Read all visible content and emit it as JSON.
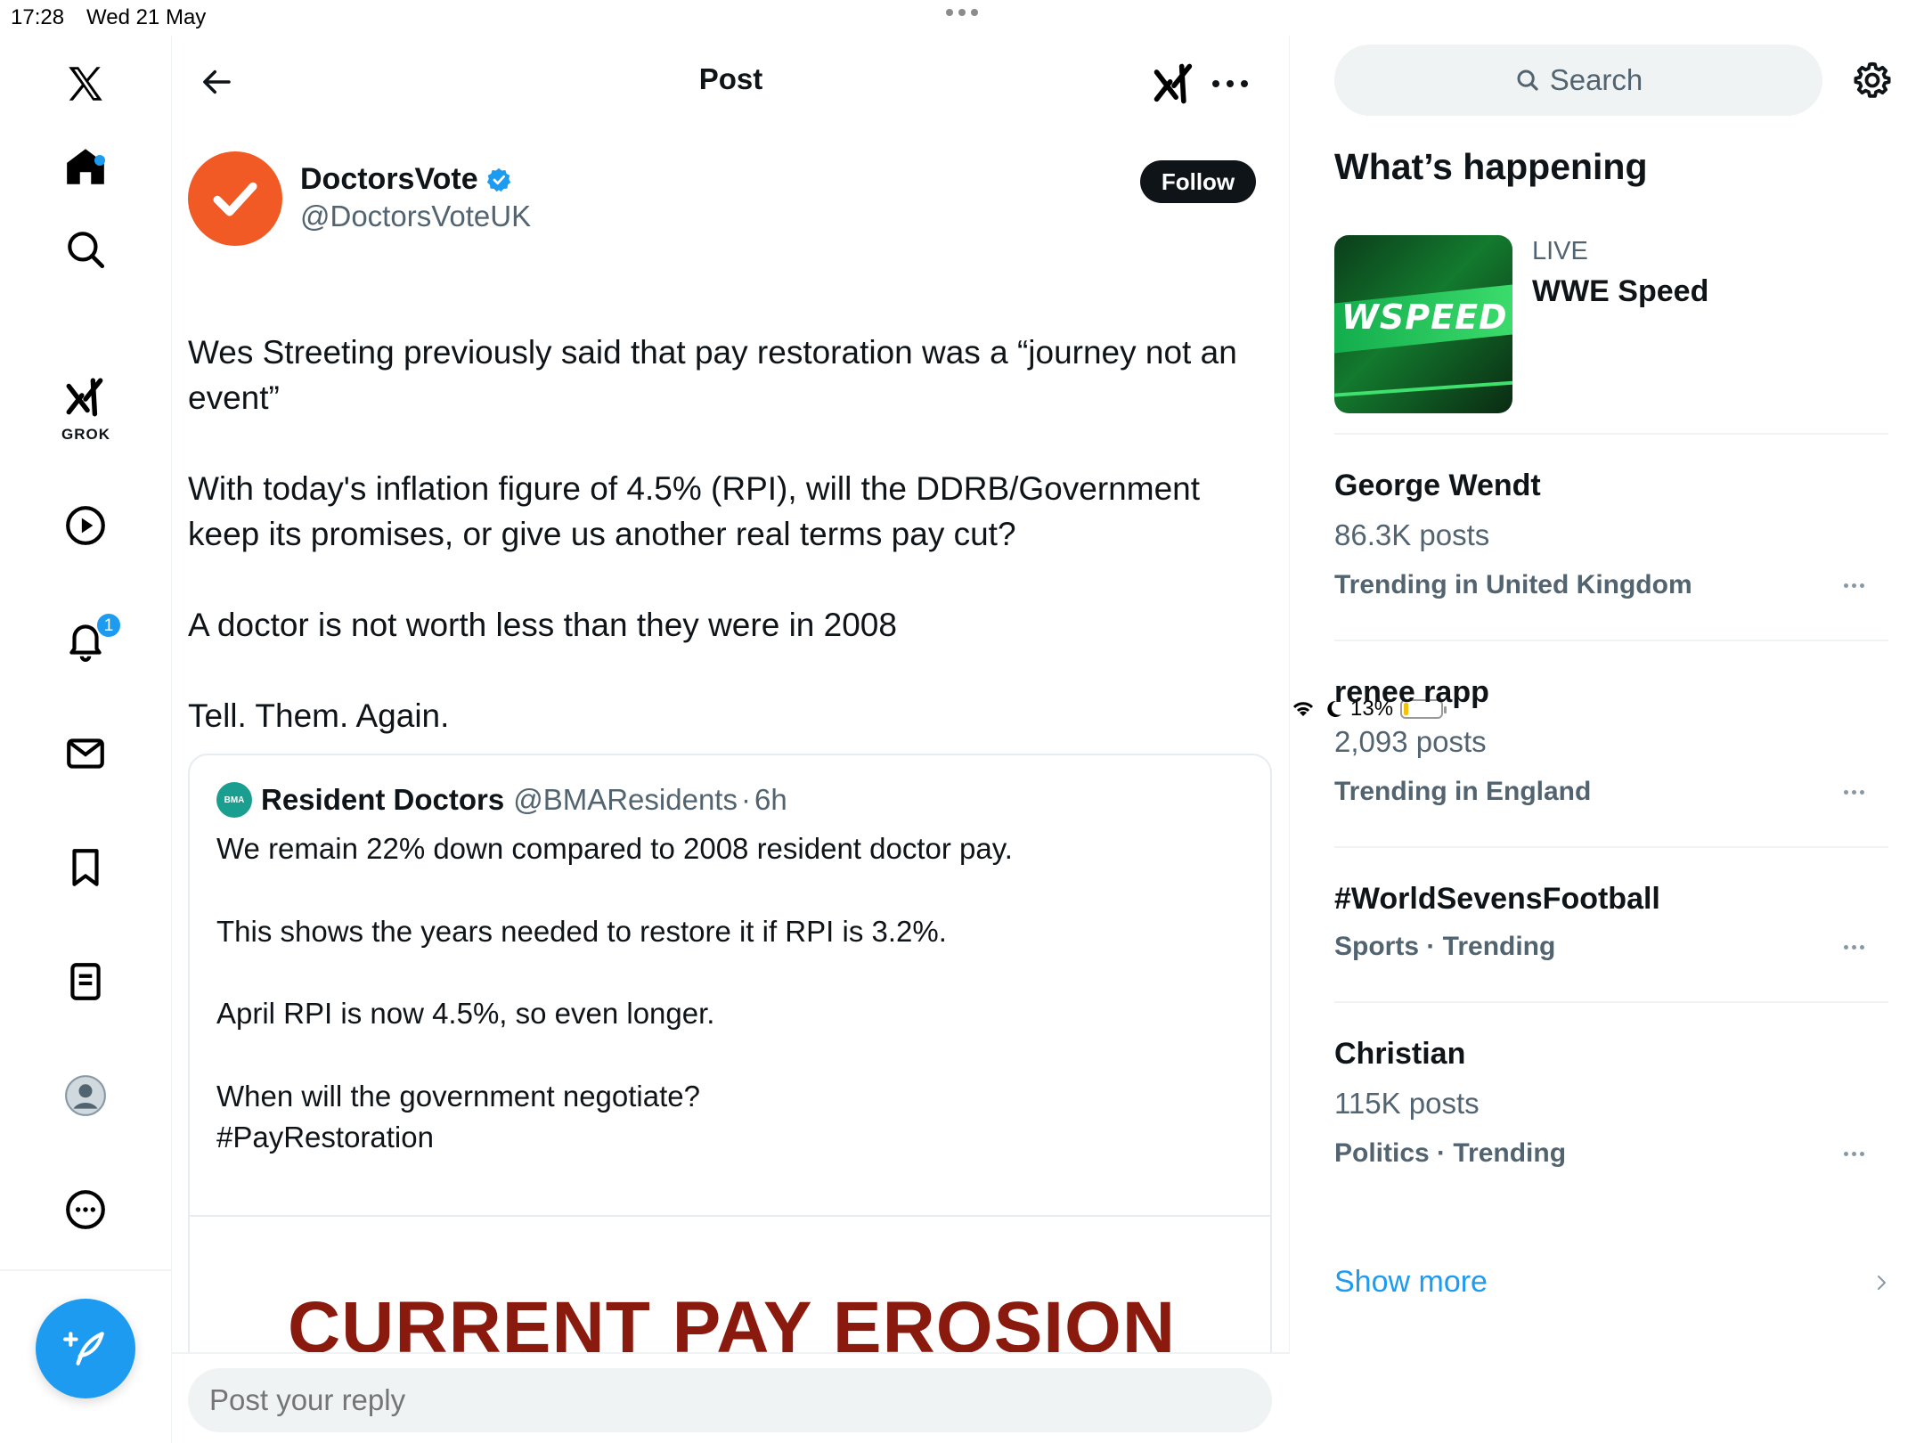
{
  "status_bar": {
    "time": "17:28",
    "date": "Wed 21 May",
    "battery": "13%",
    "battery_level_fraction": 0.13
  },
  "left_nav": {
    "items": [
      {
        "icon": "x-logo-icon"
      },
      {
        "icon": "home-icon",
        "has_dot": true
      },
      {
        "icon": "search-icon"
      },
      {
        "icon": "grok-icon",
        "label": "GROK"
      },
      {
        "icon": "video-play-icon"
      },
      {
        "icon": "bell-icon",
        "badge": "1"
      },
      {
        "icon": "mail-icon"
      },
      {
        "icon": "bookmark-icon"
      },
      {
        "icon": "lists-icon"
      },
      {
        "icon": "profile-avatar-icon"
      },
      {
        "icon": "more-circle-icon"
      }
    ],
    "compose_icon": "compose-feather-icon",
    "accent_color": "#1d9bf0"
  },
  "header": {
    "title": "Post",
    "back_icon": "arrow-left-icon",
    "grok_icon": "grok-icon",
    "more_icon": "ellipsis-icon"
  },
  "post": {
    "author_name": "DoctorsVote",
    "verified": true,
    "author_handle": "@DoctorsVoteUK",
    "avatar_color": "#f15a24",
    "follow_label": "Follow",
    "paragraphs": [
      "Wes Streeting previously said that pay restoration was a “journey not an event”",
      "With today's inflation figure of 4.5% (RPI), will the DDRB/Government keep its promises, or give us another real terms pay cut?",
      "A doctor is not worth less than they were in 2008",
      "Tell. Them. Again."
    ],
    "quote": {
      "logo_text": "BMA",
      "name": "Resident Doctors",
      "handle": "@BMAResidents",
      "separator": "·",
      "time": "6h",
      "lines": [
        "We remain 22% down compared to 2008 resident doctor pay.",
        "This shows the years needed to restore it if RPI is 3.2%.",
        "April RPI is now 4.5%, so even longer.",
        "When will the government negotiate?",
        "#PayRestoration"
      ],
      "image_title": "CURRENT PAY EROSION",
      "image_color": "#8b1a0e"
    }
  },
  "reply": {
    "placeholder": "Post your reply"
  },
  "sidebar": {
    "search_placeholder": "Search",
    "settings_icon": "gear-icon",
    "section_title": "What’s happening",
    "live": {
      "label": "LIVE",
      "title": "WWE Speed",
      "thumb_text": "SPEED"
    },
    "trends": [
      {
        "name": "George Wendt",
        "count": "86.3K posts",
        "context": "Trending in United Kingdom"
      },
      {
        "name": "renee rapp",
        "count": "2,093 posts",
        "context": "Trending in England"
      },
      {
        "name": "#WorldSevensFootball",
        "count": "",
        "context": "Sports · Trending"
      },
      {
        "name": "Christian",
        "count": "115K posts",
        "context": "Politics · Trending"
      }
    ],
    "show_more": "Show more"
  }
}
